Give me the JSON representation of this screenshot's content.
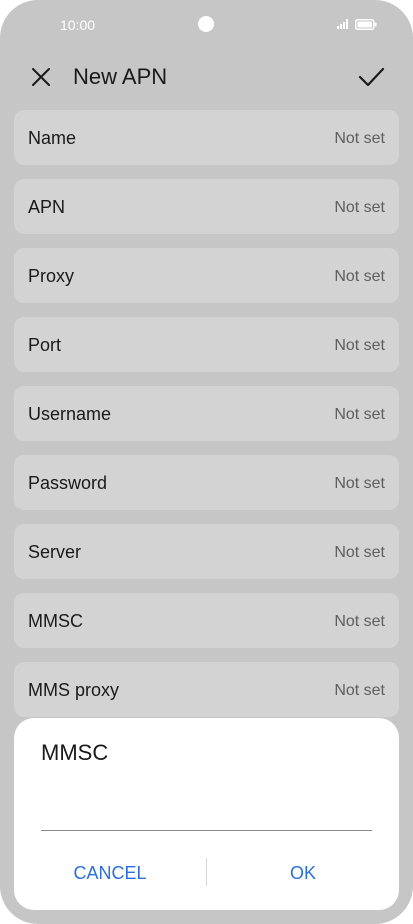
{
  "status_bar": {
    "time": "10:00",
    "icons": [
      "signal-icon",
      "battery-icon"
    ]
  },
  "header": {
    "title": "New APN",
    "close_icon": "close-icon",
    "confirm_icon": "check-icon"
  },
  "fields": [
    {
      "label": "Name",
      "value": "Not set"
    },
    {
      "label": "APN",
      "value": "Not set"
    },
    {
      "label": "Proxy",
      "value": "Not set"
    },
    {
      "label": "Port",
      "value": "Not set"
    },
    {
      "label": "Username",
      "value": "Not set"
    },
    {
      "label": "Password",
      "value": "Not set"
    },
    {
      "label": "Server",
      "value": "Not set"
    },
    {
      "label": "MMSC",
      "value": "Not set"
    },
    {
      "label": "MMS proxy",
      "value": "Not set"
    }
  ],
  "dialog": {
    "title": "MMSC",
    "input_value": "",
    "cancel_label": "CANCEL",
    "ok_label": "OK"
  },
  "colors": {
    "accent": "#2a6fdb",
    "background": "#c6c6c6",
    "row_background": "#d3d3d3"
  }
}
